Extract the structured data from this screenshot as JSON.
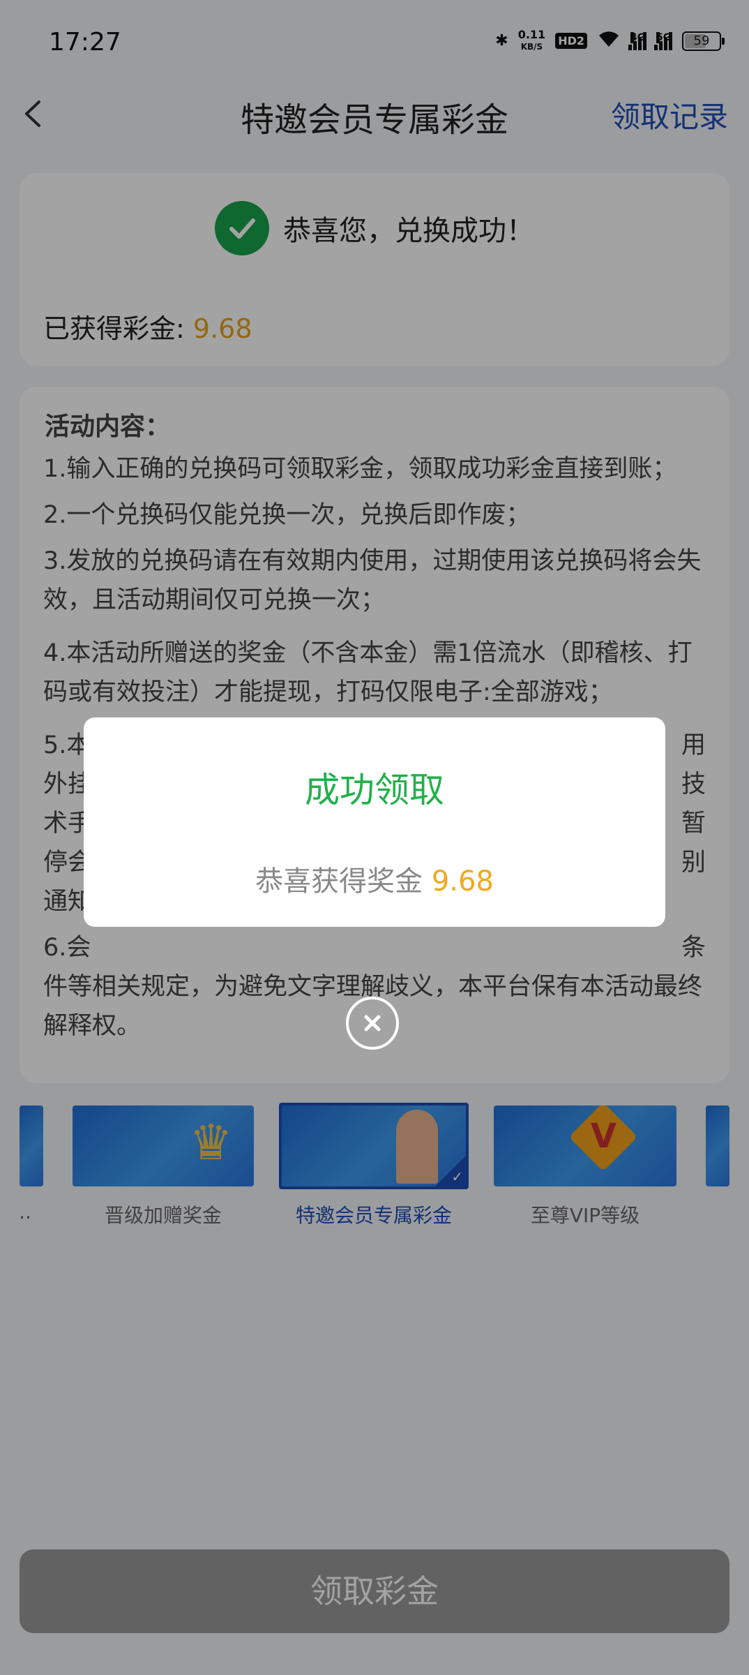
{
  "status_bar": {
    "time": "17:27",
    "net_speed": "0.11",
    "net_unit": "KB/S",
    "hd": "HD2",
    "net1": "4G",
    "net2": "5G",
    "battery": "59"
  },
  "nav": {
    "title": "特邀会员专属彩金",
    "record": "领取记录"
  },
  "success": {
    "message": "恭喜您，兑换成功！",
    "bonus_label": "已获得彩金:",
    "bonus_value": "9.68"
  },
  "rules": {
    "title": "活动内容：",
    "items": [
      "1.输入正确的兑换码可领取彩金，领取成功彩金直接到账；",
      "2.一个兑换码仅能兑换一次，兑换后即作废；",
      "3.发放的兑换码请在有效期内使用，过期使用该兑换码将会失效，且活动期间仅可兑换一次；",
      "4.本活动所赠送的奖金（不含本金）需1倍流水（即稽核、打码或有效投注）才能提现，打码仅限电子:全部游戏；",
      "5.本",
      "6.会",
      "用",
      "外挂",
      "技",
      "术手",
      "暂",
      "停会",
      "别",
      "通知",
      "件等相关规定，为避免文字理解歧义，本平台保有本活动最终解释权。",
      "条"
    ]
  },
  "gallery": {
    "items": [
      {
        "label": "..",
        "selected": false
      },
      {
        "label": "晋级加赠奖金",
        "selected": false
      },
      {
        "label": "特邀会员专属彩金",
        "selected": true
      },
      {
        "label": "至尊VIP等级",
        "selected": false
      },
      {
        "label": "",
        "selected": false
      }
    ]
  },
  "claim_button": "领取彩金",
  "modal": {
    "title": "成功领取",
    "body_label": "恭喜获得奖金",
    "amount": "9.68"
  },
  "colors": {
    "accent": "#1e4eb8",
    "success": "#22b04a",
    "gold": "#f0a91d"
  }
}
